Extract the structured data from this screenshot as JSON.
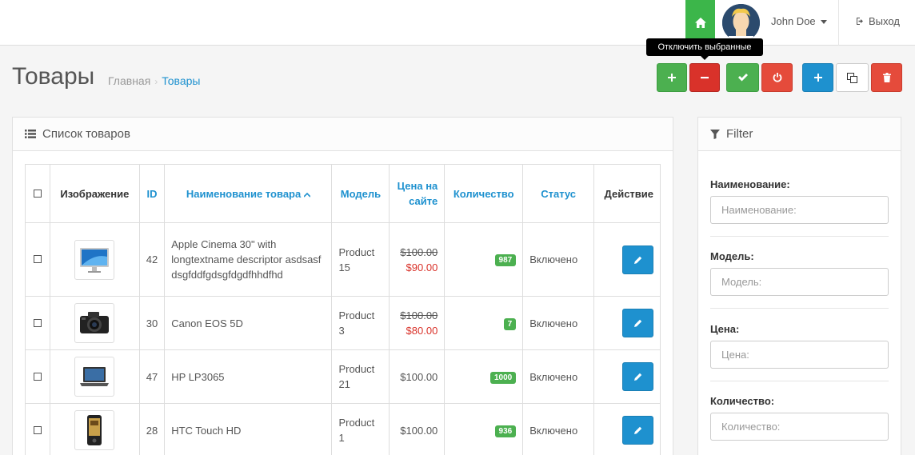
{
  "header": {
    "user_name": "John Doe",
    "logout_label": "Выход"
  },
  "page": {
    "title": "Товары",
    "breadcrumb": [
      {
        "label": "Главная"
      },
      {
        "label": "Товары"
      }
    ]
  },
  "tooltip": "Отключить выбранные",
  "list_panel": {
    "title": "Список товаров",
    "columns": {
      "image": "Изображение",
      "id": "ID",
      "name": "Наименование товара",
      "model": "Модель",
      "price": "Цена на сайте",
      "quantity": "Количество",
      "status": "Статус",
      "action": "Действие"
    },
    "rows": [
      {
        "image": "monitor",
        "id": "42",
        "name": "Apple Cinema 30\" with longtextname descriptor asdsasf dsgfddfgdsgfdgdfhhdfhd",
        "model": "Product 15",
        "old_price": "$100.00",
        "price": "$90.00",
        "quantity": "987",
        "status": "Включено"
      },
      {
        "image": "camera",
        "id": "30",
        "name": "Canon EOS 5D",
        "model": "Product 3",
        "old_price": "$100.00",
        "price": "$80.00",
        "quantity": "7",
        "status": "Включено"
      },
      {
        "image": "laptop",
        "id": "47",
        "name": "HP LP3065",
        "model": "Product 21",
        "old_price": "",
        "price": "$100.00",
        "quantity": "1000",
        "status": "Включено"
      },
      {
        "image": "phone",
        "id": "28",
        "name": "HTC Touch HD",
        "model": "Product 1",
        "old_price": "",
        "price": "$100.00",
        "quantity": "936",
        "status": "Включено"
      }
    ]
  },
  "filter_panel": {
    "title": "Filter",
    "fields": [
      {
        "label": "Наименование:",
        "placeholder": "Наименование:"
      },
      {
        "label": "Модель:",
        "placeholder": "Модель:"
      },
      {
        "label": "Цена:",
        "placeholder": "Цена:"
      },
      {
        "label": "Количество:",
        "placeholder": "Количество:"
      }
    ]
  },
  "colors": {
    "green": "#4cb050",
    "red": "#d9322a",
    "blue": "#1e91cf",
    "home_green": "#3cb64a"
  }
}
